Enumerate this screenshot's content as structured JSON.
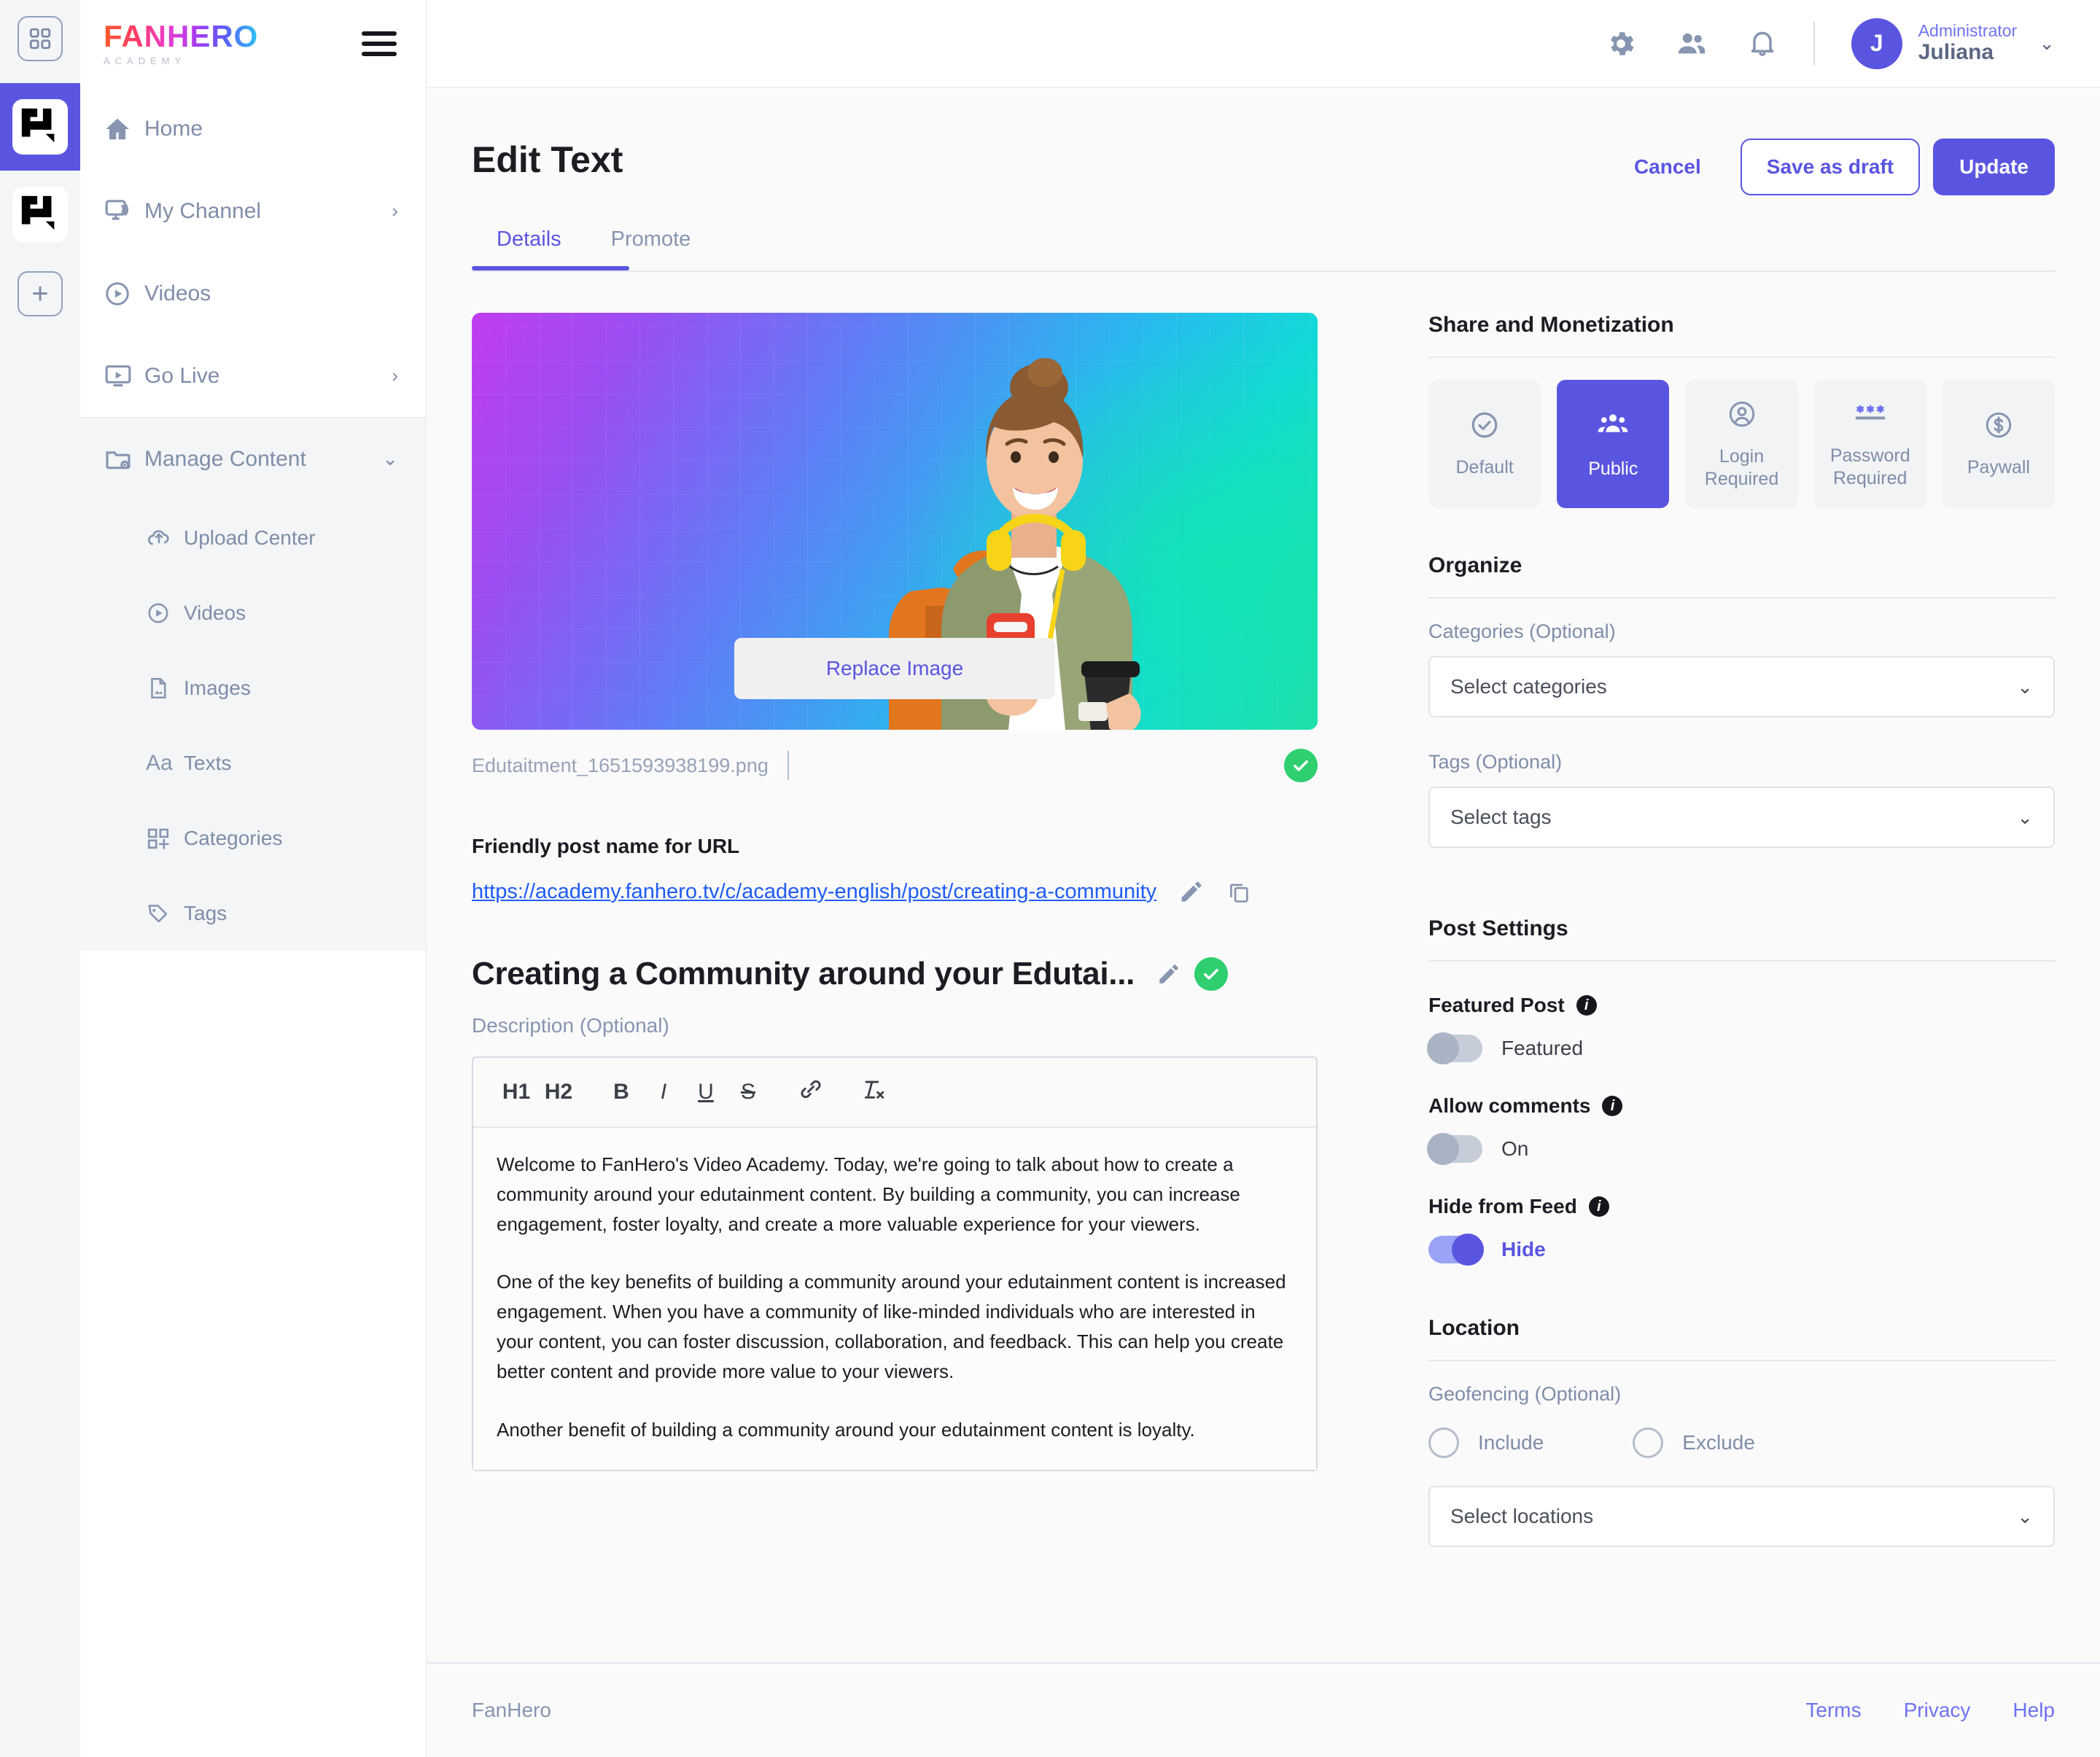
{
  "rail": {
    "apps_icon": "grid-icon",
    "channels": [
      {
        "name": "FanHero Academy",
        "active": true
      },
      {
        "name": "FanHero",
        "active": false
      }
    ],
    "add_label": "+"
  },
  "sidebar": {
    "logo_main": "FANHERO",
    "logo_sub": "ACADEMY",
    "menu_icon": "hamburger-icon",
    "items": [
      {
        "label": "Home",
        "icon": "home-icon",
        "chevron": false
      },
      {
        "label": "My Channel",
        "icon": "channel-icon",
        "chevron": true
      },
      {
        "label": "Videos",
        "icon": "play-circle-icon",
        "chevron": false
      },
      {
        "label": "Go Live",
        "icon": "live-icon",
        "chevron": true
      }
    ],
    "manage": {
      "label": "Manage Content",
      "icon": "folder-gear-icon",
      "expanded": true,
      "children": [
        {
          "label": "Upload Center",
          "icon": "cloud-upload-icon"
        },
        {
          "label": "Videos",
          "icon": "play-circle-icon"
        },
        {
          "label": "Images",
          "icon": "image-file-icon"
        },
        {
          "label": "Texts",
          "icon": "text-aa-icon"
        },
        {
          "label": "Categories",
          "icon": "categories-grid-plus-icon"
        },
        {
          "label": "Tags",
          "icon": "tag-icon"
        }
      ]
    }
  },
  "topbar": {
    "icons": [
      "gear-icon",
      "people-icon",
      "bell-icon"
    ],
    "user": {
      "avatar_initial": "J",
      "role": "Administrator",
      "name": "Juliana",
      "chevron": "chevron-down-icon"
    }
  },
  "page": {
    "title": "Edit Text",
    "actions": {
      "cancel": "Cancel",
      "save_draft": "Save as draft",
      "update": "Update"
    },
    "tabs": [
      {
        "label": "Details",
        "active": true
      },
      {
        "label": "Promote",
        "active": false
      }
    ]
  },
  "media": {
    "replace_button": "Replace Image",
    "file_name": "Edutaitment_1651593938199.png",
    "status_icon": "check-circle-icon"
  },
  "url_section": {
    "label": "Friendly post name for URL",
    "url": "https://academy.fanhero.tv/c/academy-english/post/creating-a-community",
    "edit_icon": "pencil-icon",
    "copy_icon": "copy-icon"
  },
  "post": {
    "title": "Creating a Community around your Edutai...",
    "edit_icon": "pencil-icon",
    "status_icon": "check-circle-icon",
    "description_label": "Description (Optional)",
    "toolbar": [
      "H1",
      "H2",
      "B",
      "I",
      "U",
      "S",
      "link-icon",
      "clear-format-icon"
    ],
    "paragraphs": [
      "Welcome to FanHero's Video Academy. Today, we're going to talk about how to create a community around your edutainment content. By building a community, you can increase engagement, foster loyalty, and create a more valuable experience for your viewers.",
      "One of the key benefits of building a community around your edutainment content is increased engagement. When you have a community of like-minded individuals who are interested in your content, you can foster discussion, collaboration, and feedback. This can help you create better content and provide more value to your viewers.",
      "Another benefit of building a community around your edutainment content is loyalty."
    ]
  },
  "share": {
    "title": "Share and Monetization",
    "options": [
      {
        "label": "Default",
        "icon": "check-circle-outline-icon",
        "active": false
      },
      {
        "label": "Public",
        "icon": "people-group-icon",
        "active": true
      },
      {
        "label": "Login\nRequired",
        "label_l1": "Login",
        "label_l2": "Required",
        "icon": "user-circle-icon",
        "active": false
      },
      {
        "label": "Password\nRequired",
        "label_l1": "Password",
        "label_l2": "Required",
        "icon": "asterisk-password-icon",
        "active": false
      },
      {
        "label": "Paywall",
        "icon": "dollar-circle-icon",
        "active": false
      }
    ]
  },
  "organize": {
    "title": "Organize",
    "categories_label": "Categories (Optional)",
    "categories_value": "Select categories",
    "tags_label": "Tags (Optional)",
    "tags_value": "Select tags"
  },
  "post_settings": {
    "title": "Post Settings",
    "featured": {
      "label": "Featured Post",
      "toggle_text": "Featured",
      "on": false
    },
    "comments": {
      "label": "Allow comments",
      "toggle_text": "On",
      "on": false
    },
    "hide_feed": {
      "label": "Hide from Feed",
      "toggle_text": "Hide",
      "on": true
    }
  },
  "location": {
    "title": "Location",
    "geofencing_label": "Geofencing (Optional)",
    "include_label": "Include",
    "exclude_label": "Exclude",
    "select_value": "Select locations"
  },
  "footer": {
    "brand": "FanHero",
    "links": [
      "Terms",
      "Privacy",
      "Help"
    ]
  },
  "colors": {
    "accent": "#5a55e0",
    "link": "#1f5cf5",
    "muted": "#7f8da9",
    "success": "#2fcf6f"
  }
}
